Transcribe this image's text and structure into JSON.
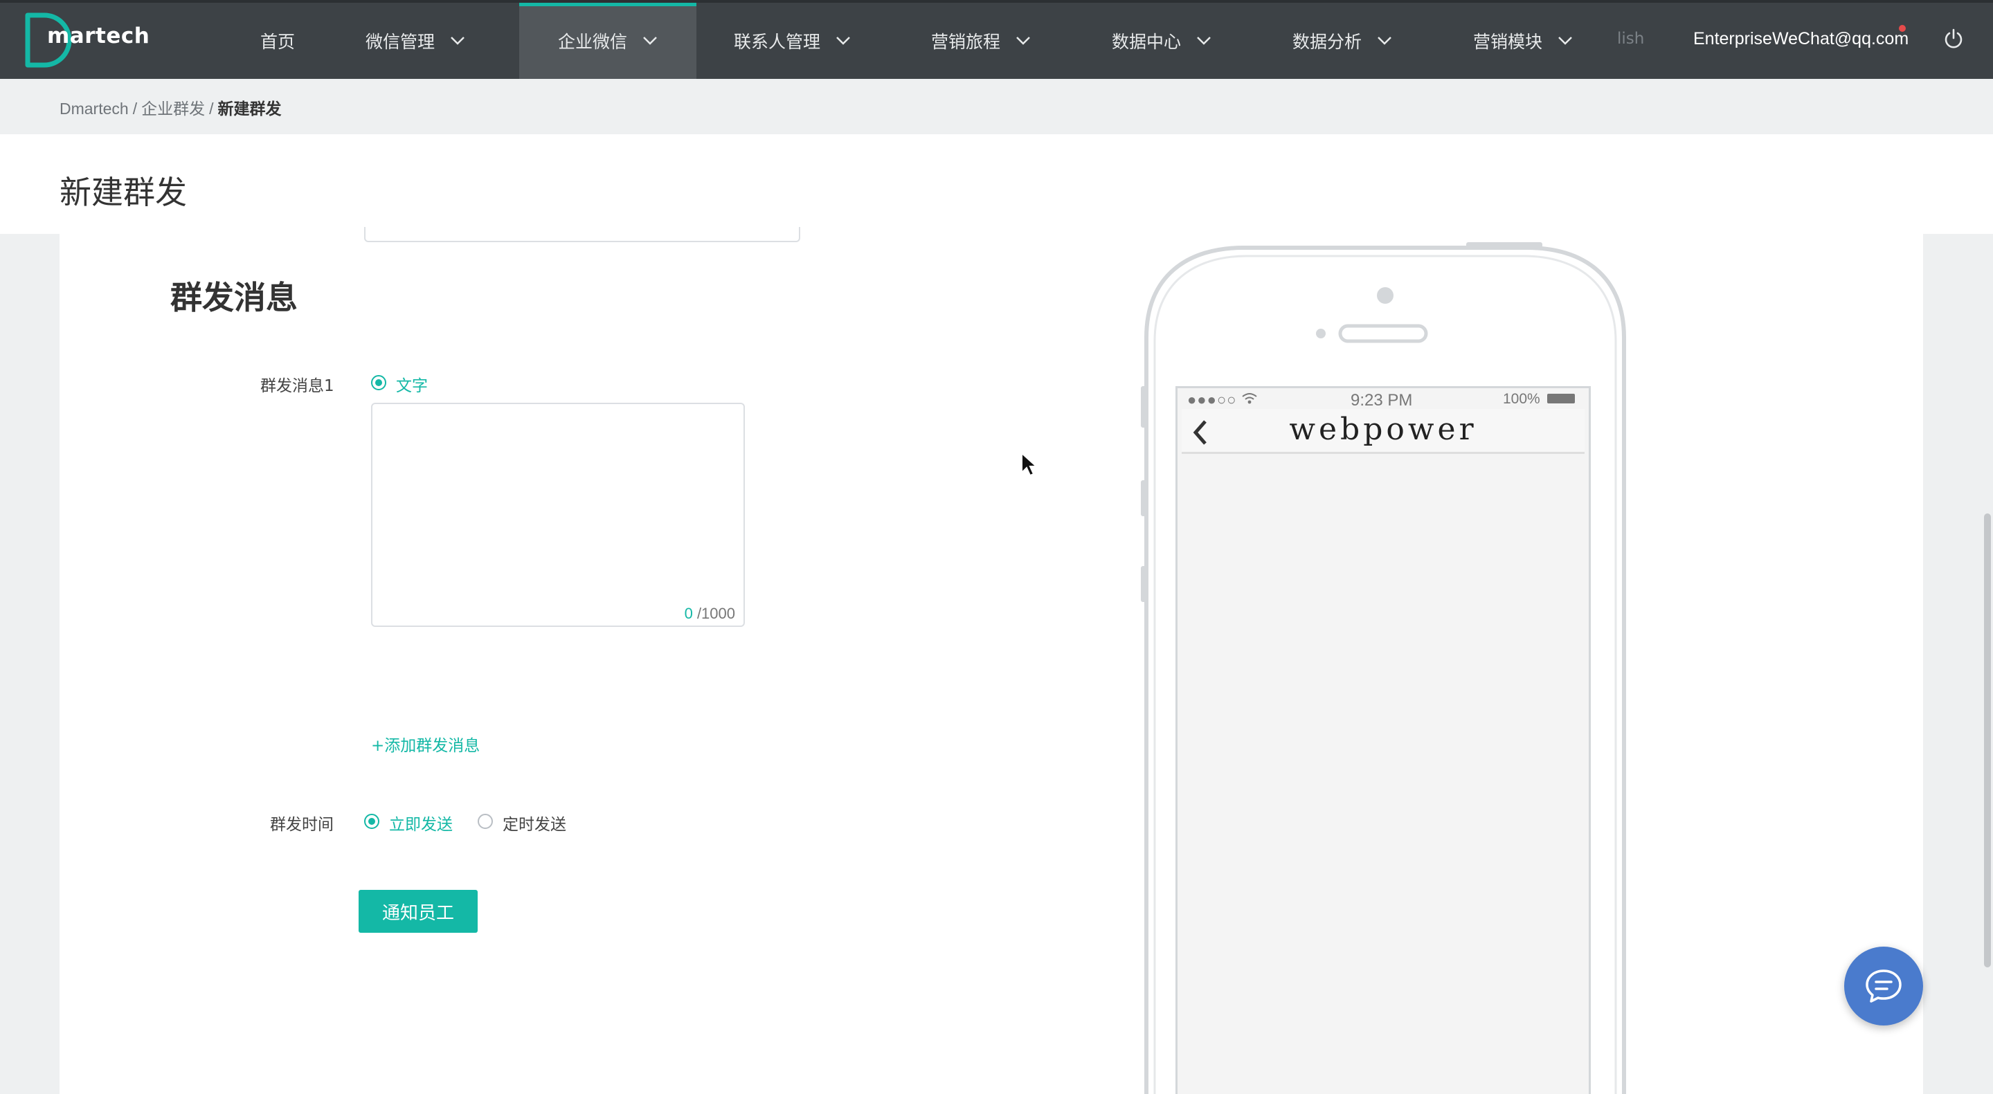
{
  "app": {
    "logo_text": "martech",
    "brand_color": "#14b8a6",
    "nav_bg": "#3d4246"
  },
  "nav": {
    "items": [
      {
        "label": "首页",
        "has_dropdown": false,
        "active": false
      },
      {
        "label": "微信管理",
        "has_dropdown": true,
        "active": false
      },
      {
        "label": "企业微信",
        "has_dropdown": true,
        "active": true
      },
      {
        "label": "联系人管理",
        "has_dropdown": true,
        "active": false
      },
      {
        "label": "营销旅程",
        "has_dropdown": true,
        "active": false
      },
      {
        "label": "数据中心",
        "has_dropdown": true,
        "active": false
      },
      {
        "label": "数据分析",
        "has_dropdown": true,
        "active": false
      },
      {
        "label": "营销模块",
        "has_dropdown": true,
        "active": false
      }
    ],
    "lang_text": "lish",
    "user_email": "EnterpriseWeChat@qq.com",
    "power_icon": "power-icon"
  },
  "breadcrumb": {
    "items": [
      "Dmartech",
      "企业群发",
      "新建群发"
    ],
    "separator": "/"
  },
  "page": {
    "title": "新建群发"
  },
  "form": {
    "section_title": "群发消息",
    "message1": {
      "label": "群发消息1",
      "type_option": "文字",
      "type_selected": true,
      "content": "",
      "char_count": "0",
      "char_limit": "/1000"
    },
    "add_message_link": "+添加群发消息",
    "send_time": {
      "label": "群发时间",
      "options": [
        {
          "label": "立即发送",
          "selected": true
        },
        {
          "label": "定时发送",
          "selected": false
        }
      ]
    },
    "submit_label": "通知员工"
  },
  "preview": {
    "status_time": "9:23 PM",
    "battery": "100%",
    "header_title": "webpower",
    "back_icon": "chevron-left-icon"
  },
  "chat_fab_icon": "chat-bubble-icon"
}
